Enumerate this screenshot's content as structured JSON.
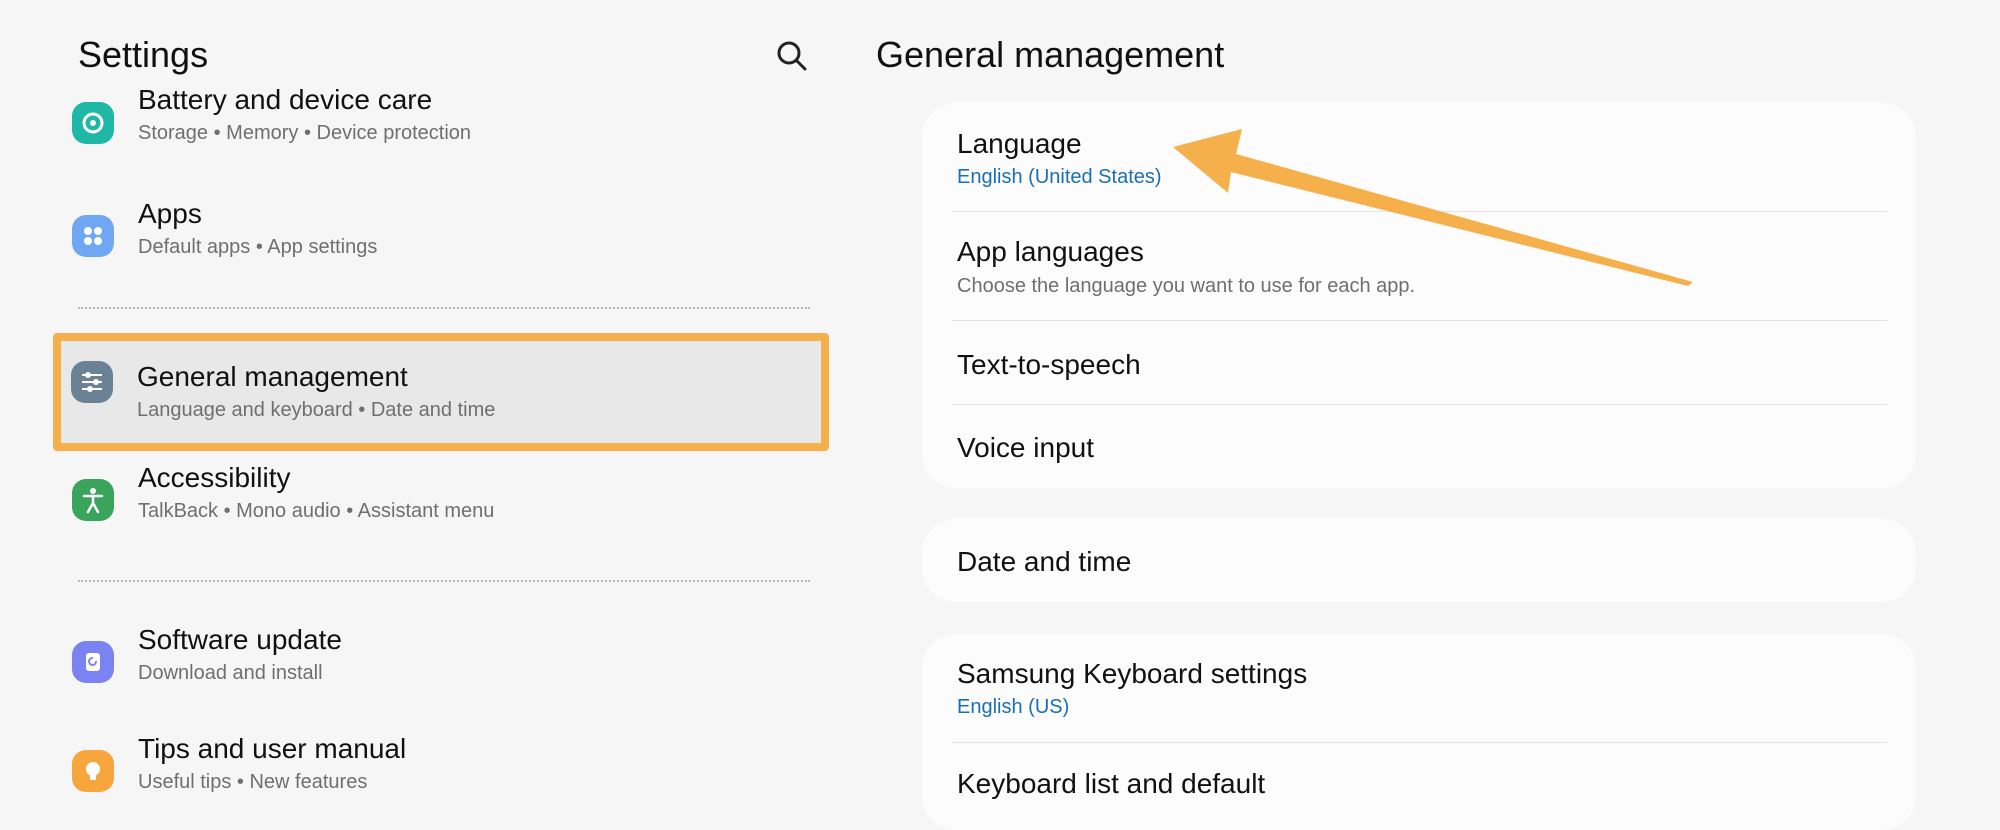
{
  "left": {
    "title": "Settings",
    "items": [
      {
        "label": "Battery and device care",
        "subtitle": "Storage  •  Memory  •  Device protection",
        "icon": "battery-care-icon",
        "icon_color": "#1fb7a6"
      },
      {
        "label": "Apps",
        "subtitle": "Default apps  •  App settings",
        "icon": "apps-icon",
        "icon_color": "#6fa7f2"
      },
      {
        "label": "General management",
        "subtitle": "Language and keyboard  •  Date and time",
        "icon": "sliders-icon",
        "icon_color": "#6a8196"
      },
      {
        "label": "Accessibility",
        "subtitle": "TalkBack  •  Mono audio  •  Assistant menu",
        "icon": "accessibility-icon",
        "icon_color": "#3aa35c"
      },
      {
        "label": "Software update",
        "subtitle": "Download and install",
        "icon": "software-update-icon",
        "icon_color": "#7b83f2"
      },
      {
        "label": "Tips and user manual",
        "subtitle": "Useful tips  •  New features",
        "icon": "lightbulb-icon",
        "icon_color": "#f7a53d"
      }
    ]
  },
  "right": {
    "title": "General management",
    "groups": [
      {
        "rows": [
          {
            "label": "Language",
            "subtitle": "English (United States)"
          },
          {
            "label": "App languages",
            "subtitle": "Choose the language you want to use for each app."
          },
          {
            "label": "Text-to-speech"
          },
          {
            "label": "Voice input"
          }
        ]
      },
      {
        "rows": [
          {
            "label": "Date and time"
          }
        ]
      },
      {
        "rows": [
          {
            "label": "Samsung Keyboard settings",
            "subtitle": "English (US)"
          },
          {
            "label": "Keyboard list and default"
          }
        ]
      }
    ]
  },
  "annotation": {
    "color": "#f5b04c"
  }
}
